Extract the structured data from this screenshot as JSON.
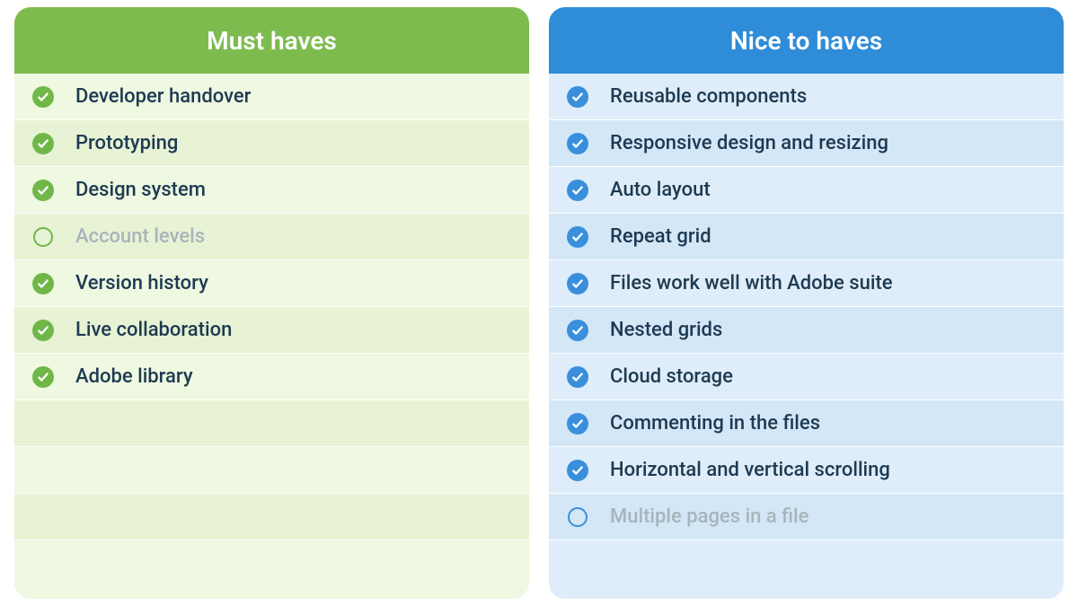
{
  "colors": {
    "must_header": "#7dbb4f",
    "must_check": "#70b74a",
    "must_stripe_a": "#eff8e1",
    "must_stripe_b": "#e7f3d4",
    "nice_header": "#2e8cd8",
    "nice_check": "#3a8fdc",
    "nice_stripe_a": "#deedf9",
    "nice_stripe_b": "#d3e7f7",
    "text_primary": "#1e3a52",
    "text_muted": "#a7b5bc"
  },
  "must": {
    "title": "Must haves",
    "items": [
      {
        "label": "Developer handover",
        "checked": true
      },
      {
        "label": "Prototyping",
        "checked": true
      },
      {
        "label": "Design system",
        "checked": true
      },
      {
        "label": "Account levels",
        "checked": false
      },
      {
        "label": "Version history",
        "checked": true
      },
      {
        "label": "Live collaboration",
        "checked": true
      },
      {
        "label": "Adobe library",
        "checked": true
      }
    ]
  },
  "nice": {
    "title": "Nice to haves",
    "items": [
      {
        "label": "Reusable components",
        "checked": true
      },
      {
        "label": "Responsive design and resizing",
        "checked": true
      },
      {
        "label": "Auto layout",
        "checked": true
      },
      {
        "label": "Repeat grid",
        "checked": true
      },
      {
        "label": "Files work well with Adobe suite",
        "checked": true
      },
      {
        "label": "Nested grids",
        "checked": true
      },
      {
        "label": "Cloud storage",
        "checked": true
      },
      {
        "label": "Commenting in the files",
        "checked": true
      },
      {
        "label": "Horizontal and vertical scrolling",
        "checked": true
      },
      {
        "label": "Multiple pages in a file",
        "checked": false
      }
    ]
  }
}
